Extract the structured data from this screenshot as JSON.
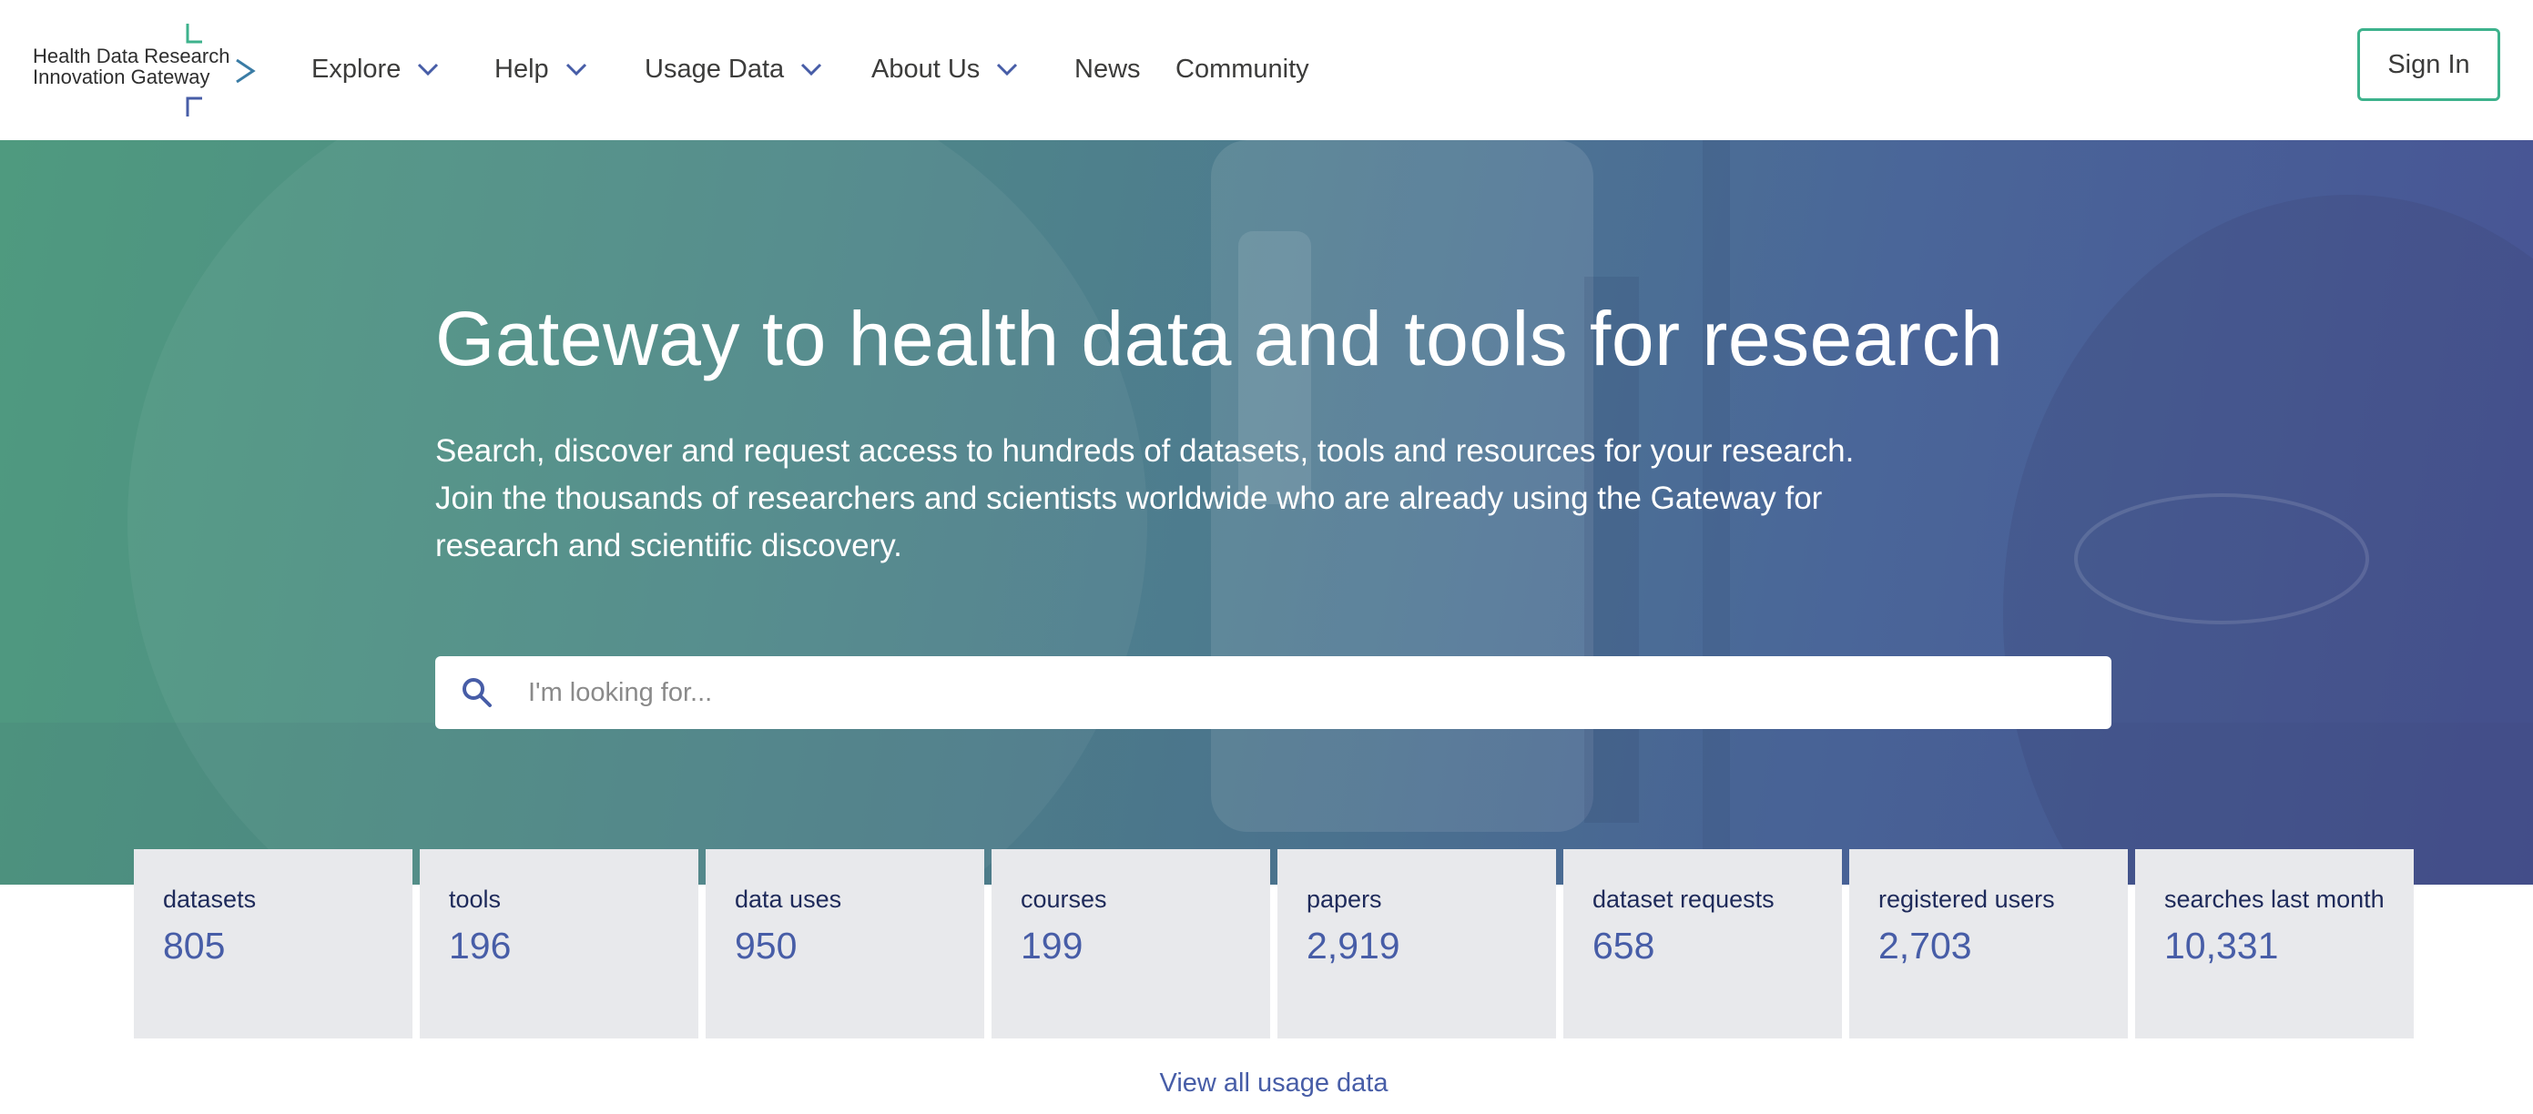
{
  "header": {
    "logo": {
      "line1": "Health Data Research",
      "line2": "Innovation Gateway"
    },
    "nav": [
      {
        "label": "Explore",
        "has_dropdown": true
      },
      {
        "label": "Help",
        "has_dropdown": true
      },
      {
        "label": "Usage Data",
        "has_dropdown": true
      },
      {
        "label": "About Us",
        "has_dropdown": true
      },
      {
        "label": "News",
        "has_dropdown": false
      },
      {
        "label": "Community",
        "has_dropdown": false
      }
    ],
    "sign_in_label": "Sign In"
  },
  "hero": {
    "title": "Gateway to health data and tools for research",
    "subtitle": "Search, discover and request access to hundreds of datasets, tools and resources for your research. Join the thousands of researchers and scientists worldwide who are already using the Gateway for research and scientific discovery.",
    "search": {
      "placeholder": "I'm looking for...",
      "value": ""
    }
  },
  "stats": [
    {
      "label": "datasets",
      "value": "805"
    },
    {
      "label": "tools",
      "value": "196"
    },
    {
      "label": "data uses",
      "value": "950"
    },
    {
      "label": "courses",
      "value": "199"
    },
    {
      "label": "papers",
      "value": "2,919"
    },
    {
      "label": "dataset requests",
      "value": "658"
    },
    {
      "label": "registered users",
      "value": "2,703"
    },
    {
      "label": "searches last month",
      "value": "10,331"
    }
  ],
  "view_all_label": "View all usage data",
  "colors": {
    "accent_green": "#3db28c",
    "accent_blue": "#475da7",
    "stat_background": "#e8e9ec",
    "logo_teal": "#3a9a9d"
  },
  "icons": {
    "search": "search-icon",
    "dropdown": "chevron-down-icon",
    "logo_arrow": "chevron-right-icon"
  }
}
